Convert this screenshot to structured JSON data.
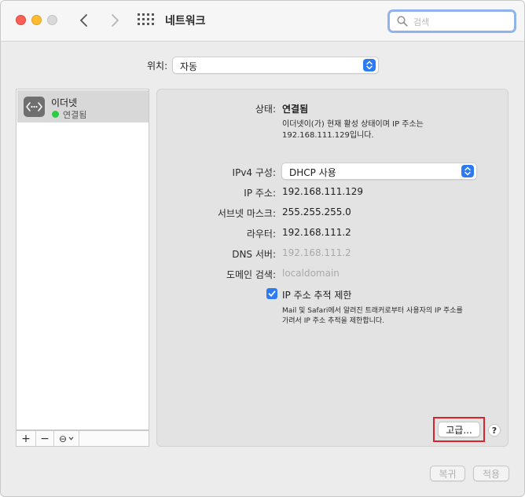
{
  "window": {
    "title": "네트워크",
    "search_placeholder": "검색"
  },
  "location": {
    "label": "위치:",
    "value": "자동"
  },
  "sidebar": {
    "items": [
      {
        "name": "이더넷",
        "status": "연결됨",
        "status_color": "#2ecc40",
        "icon": "ethernet-icon"
      }
    ],
    "toolbar": {
      "add": "+",
      "remove": "−",
      "action": "⊖"
    }
  },
  "detail": {
    "status_label": "상태:",
    "status_value": "연결됨",
    "status_desc_line1": "이더넷이(가) 현재 활성 상태이며 IP 주소는",
    "status_desc_line2": "192.168.111.129입니다.",
    "ipv4_label": "IPv4 구성:",
    "ipv4_value": "DHCP 사용",
    "ip_label": "IP 주소:",
    "ip_value": "192.168.111.129",
    "subnet_label": "서브넷 마스크:",
    "subnet_value": "255.255.255.0",
    "router_label": "라우터:",
    "router_value": "192.168.111.2",
    "dns_label": "DNS 서버:",
    "dns_value": "192.168.111.2",
    "domain_label": "도메인 검색:",
    "domain_value": "localdomain",
    "limit_tracking_label": "IP 주소 추적 제한",
    "limit_tracking_checked": true,
    "limit_desc_line1": "Mail 및 Safari에서 알려진 트래커로부터 사용자의 IP 주소를",
    "limit_desc_line2": "가려서 IP 주소 추적을 제한합니다.",
    "advanced_button": "고급...",
    "help_button": "?"
  },
  "footer": {
    "revert_button": "복귀",
    "apply_button": "적용"
  },
  "colors": {
    "accent": "#2c7bf2",
    "highlight_frame": "#d8232a"
  }
}
